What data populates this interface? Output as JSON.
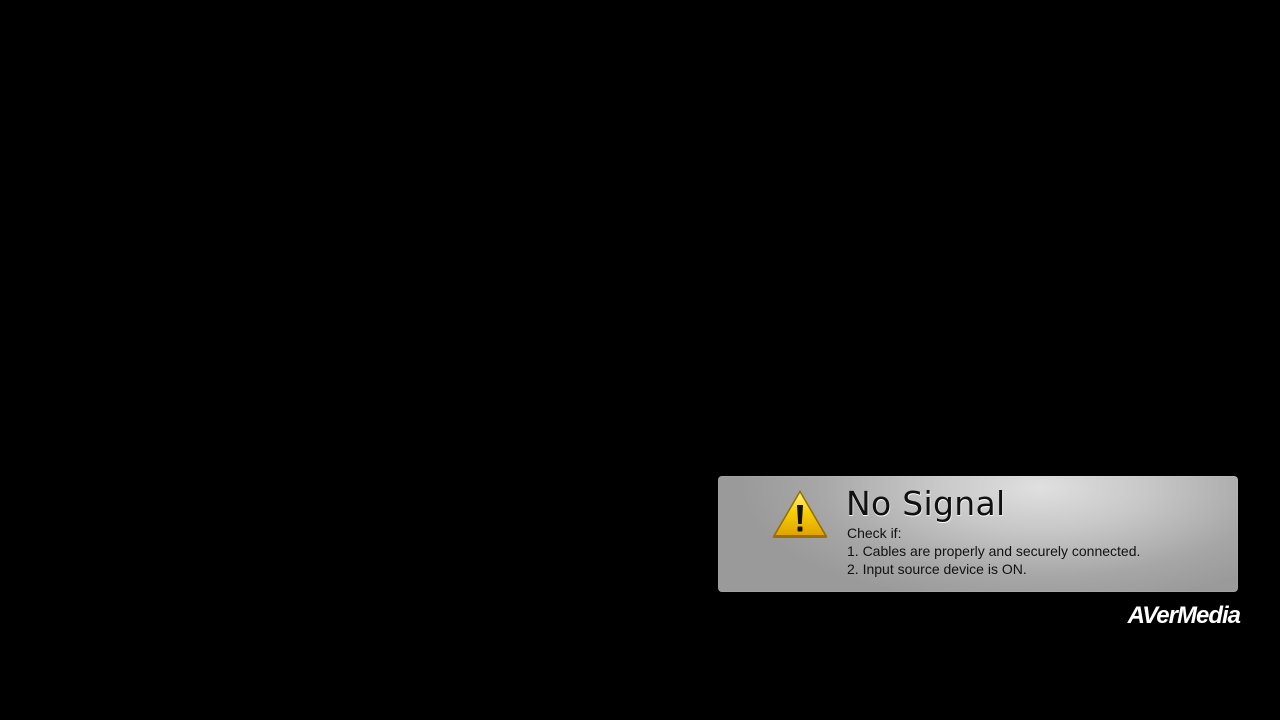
{
  "dialog": {
    "title": "No Signal",
    "check_label": "Check if:",
    "items": [
      "1. Cables are properly and securely connected.",
      "2. Input source device is ON."
    ],
    "icon": "warning-icon"
  },
  "branding": {
    "logo_text": "AVerMedia"
  },
  "colors": {
    "background": "#000000",
    "panel": "#b4b4b4",
    "warning_yellow": "#f5c400"
  }
}
